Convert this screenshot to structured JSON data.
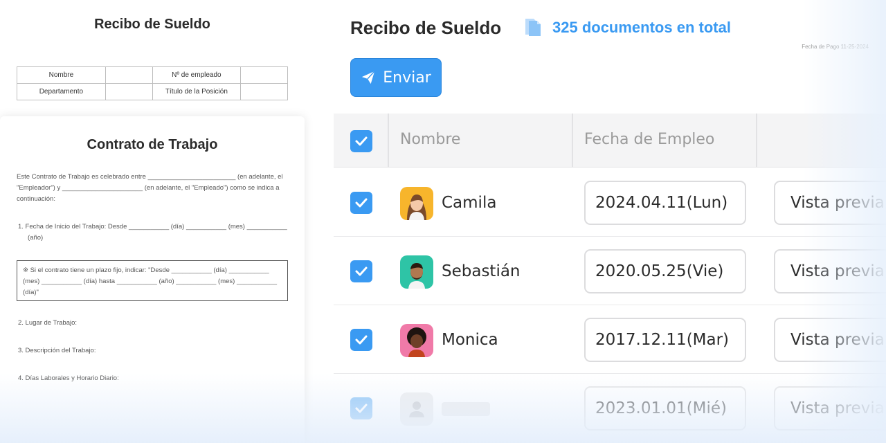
{
  "payslip": {
    "title": "Recibo de Sueldo",
    "pay_date": "Fecha de Pago 11-25-2024",
    "table": [
      [
        "Nombre",
        "",
        "Nº de empleado",
        ""
      ],
      [
        "Departamento",
        "",
        "Título de la Posición",
        ""
      ]
    ]
  },
  "contract": {
    "title": "Contrato de Trabajo",
    "intro": "Este Contrato de Trabajo es celebrado entre ________________________ (en adelante, el \"Empleador\") y ______________________ (en adelante, el \"Empleado\") como se indica a continuación:",
    "item1": "1. Fecha de Inicio del Trabajo: Desde ___________ (día) ___________ (mes) ___________ (año)",
    "note": "※ Si el contrato tiene un plazo fijo, indicar: \"Desde ___________ (día) ___________ (mes) ___________ (día) hasta ___________ (año) ___________ (mes) ___________ (día)\"",
    "item2": "2. Lugar de Trabajo:",
    "item3": "3. Descripción del Trabajo:",
    "item4": "4. Días Laborales y Horario Diario:"
  },
  "app": {
    "title": "Recibo de Sueldo",
    "doc_count": "325 documentos en total",
    "doc_icon": "document-stack-icon",
    "send_label": "Enviar",
    "send_icon": "paper-plane-icon",
    "accent_color": "#3a9af2"
  },
  "table": {
    "headers": [
      "Nombre",
      "Fecha de Empleo",
      ""
    ],
    "rows": [
      {
        "name": "Camila",
        "date": "2024.04.11(Lun)",
        "preview": "Vista previa",
        "checked": true,
        "avatar_bg": "#f7b52c"
      },
      {
        "name": "Sebastián",
        "date": "2020.05.25(Vie)",
        "preview": "Vista previa",
        "checked": true,
        "avatar_bg": "#2ec4a6"
      },
      {
        "name": "Monica",
        "date": "2017.12.11(Mar)",
        "preview": "Vista previa",
        "checked": true,
        "avatar_bg": "#f07aa8"
      },
      {
        "name": "",
        "date": "2023.01.01(Mié)",
        "preview": "Vista previa",
        "checked": true,
        "avatar_bg": "#eeeeef"
      }
    ]
  }
}
